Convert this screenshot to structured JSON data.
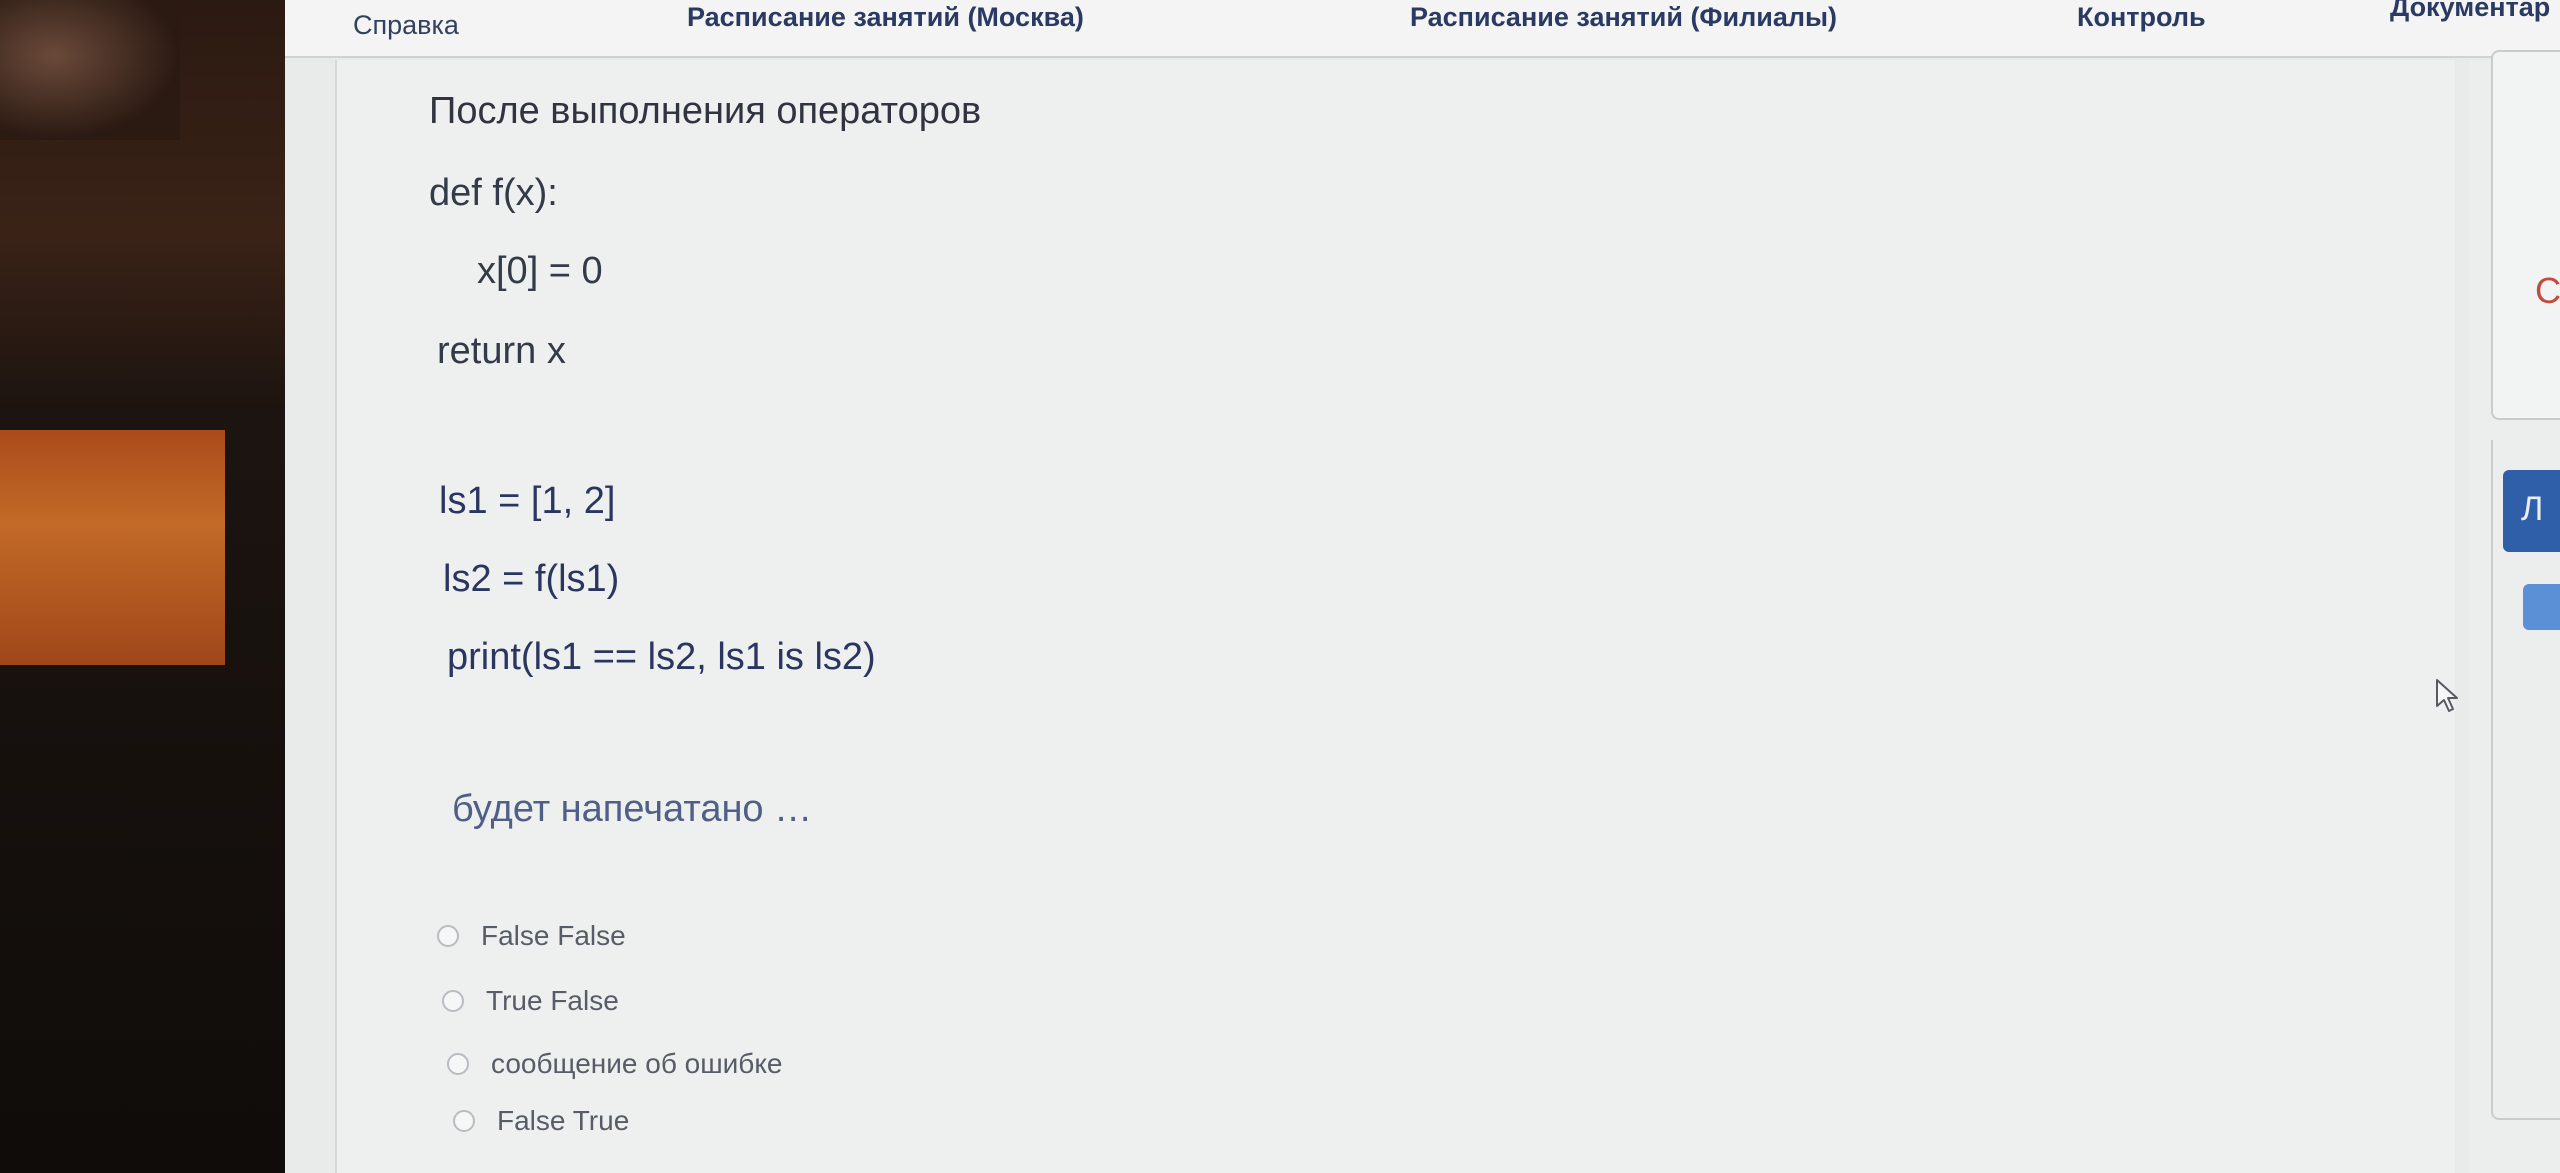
{
  "nav": {
    "help": "Справка",
    "schedule_moscow": "Расписание занятий (Москва)",
    "schedule_branches": "Расписание занятий (Филиалы)",
    "control": "Контроль",
    "documents": "Документар"
  },
  "question": {
    "intro": "После выполнения операторов",
    "code_lines": [
      "def f(x):",
      "x[0] = 0",
      "return x",
      "ls1 = [1, 2]",
      "ls2 = f(ls1)",
      "print(ls1 == ls2, ls1 is ls2)"
    ],
    "prompt": "будет напечатано …",
    "options": [
      {
        "label": "False False"
      },
      {
        "label": "True False"
      },
      {
        "label": "сообщение об ошибке"
      },
      {
        "label": "False True"
      }
    ]
  },
  "sidebar": {
    "letter_c": "С",
    "blue_button_label": "Л"
  }
}
